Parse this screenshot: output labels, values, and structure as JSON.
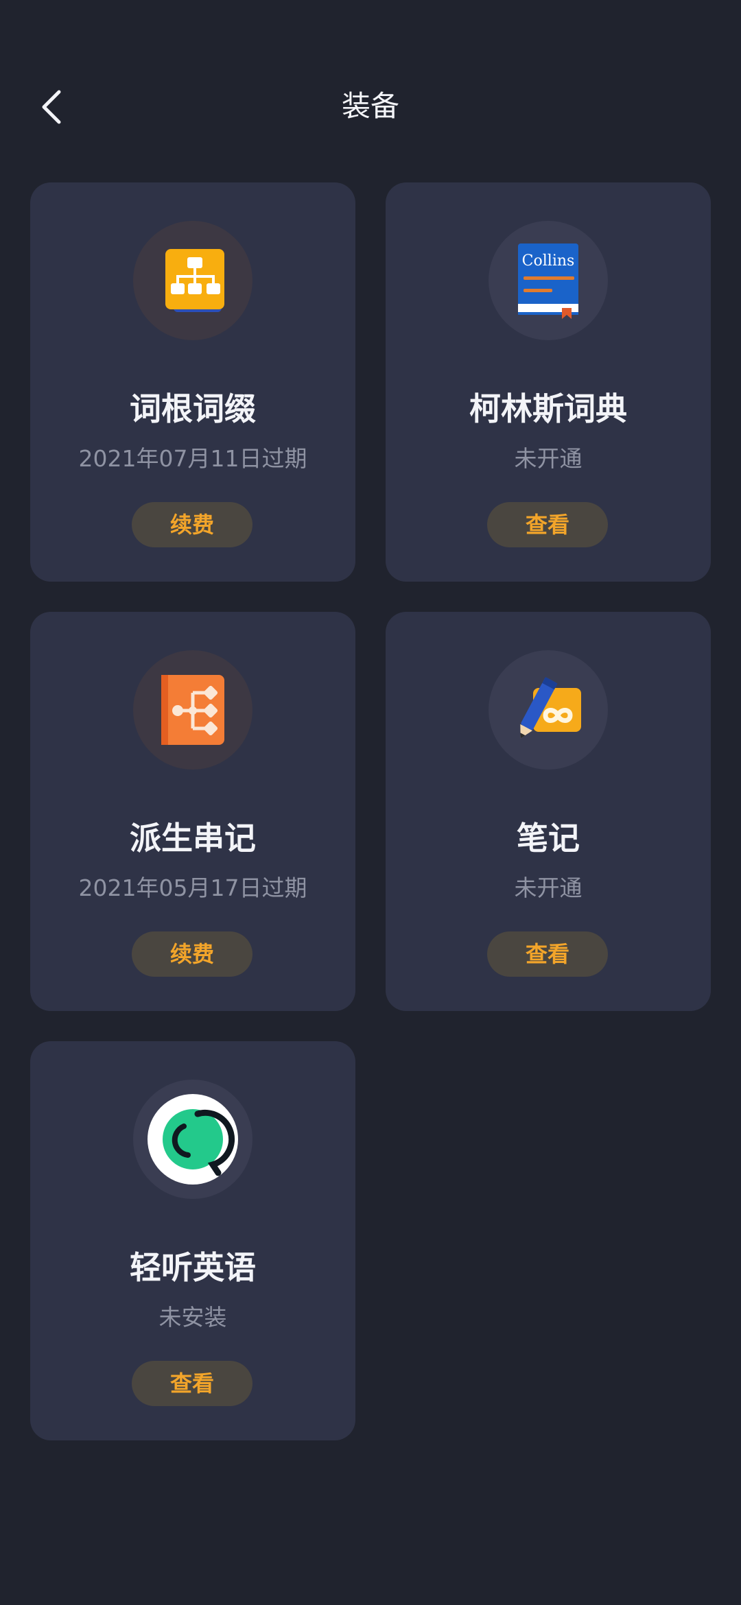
{
  "header": {
    "title": "装备",
    "back_icon": "chevron-left-icon"
  },
  "colors": {
    "background": "#20232e",
    "card": "#2f3347",
    "button_bg": "#4a4640",
    "button_text": "#f3a52a",
    "title_text": "#f3f4f8",
    "status_text": "#8f93a3"
  },
  "cards": [
    {
      "name": "词根词缀",
      "status": "2021年07月11日过期",
      "button": "续费",
      "icon": "root-affix-icon"
    },
    {
      "name": "柯林斯词典",
      "status": "未开通",
      "button": "查看",
      "icon": "collins-dictionary-icon",
      "icon_text": "Collins"
    },
    {
      "name": "派生串记",
      "status": "2021年05月17日过期",
      "button": "续费",
      "icon": "derivation-tree-icon"
    },
    {
      "name": "笔记",
      "status": "未开通",
      "button": "查看",
      "icon": "notes-pencil-icon"
    },
    {
      "name": "轻听英语",
      "status": "未安装",
      "button": "查看",
      "icon": "qingting-english-icon"
    }
  ]
}
